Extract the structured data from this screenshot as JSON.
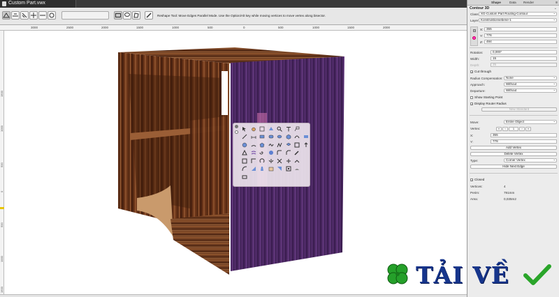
{
  "window": {
    "title": "Custom Part.vwx"
  },
  "toolbar": {
    "hint": "Reshape Tool: Move Edges Parallel Mode. Use the Option/Alt key while moving vertices to move vertex along bisector."
  },
  "rulers": {
    "top": [
      "3000",
      "2500",
      "2000",
      "1500",
      "1000",
      "500",
      "0",
      "500",
      "1000",
      "1500",
      "2000"
    ],
    "left": [
      "1500",
      "1000",
      "500",
      "0",
      "500",
      "1000",
      "1500"
    ]
  },
  "inspector": {
    "tabs": [
      "Shape",
      "Data",
      "Render"
    ],
    "object_type": "Contour 3D",
    "class_label": "Class:",
    "class_value": "XG-Custom Part Routing-Contour",
    "layer_label": "Layer:",
    "layer_value": "Konstruktionsebene-1",
    "x_label": "X:",
    "x_value": "355",
    "y_label": "Y:",
    "y_value": "776",
    "z_label": "Z:",
    "z_value": "484",
    "rotation_label": "Rotation:",
    "rotation_value": "0,000°",
    "width_label": "Width:",
    "width_value": "15",
    "depth_label": "Depth:",
    "depth_value": "25",
    "cut_through": "Cut through",
    "radius_comp_label": "Radius Compensation:",
    "radius_comp_value": "None",
    "approach_label": "Approach:",
    "approach_value": "Without",
    "departure_label": "Departure:",
    "departure_value": "Without",
    "show_starting_point": "Show Starting Point",
    "display_router_radius": "Display Router Radius",
    "new_standard": "New Standard",
    "move_label": "Move:",
    "move_value": "Entire Object",
    "vertex_label": "Vertex:",
    "vx_label": "X:",
    "vx_value": "355",
    "vy_label": "Y:",
    "vy_value": "778",
    "add_vertex": "Add Vertex",
    "delete_vertex": "Delete Vertex",
    "type_label": "Type:",
    "type_value": "Corner Vertex",
    "hide_next_edge": "Hide Next Edge",
    "closed": "Closed",
    "vertices_label": "Vertices:",
    "vertices_value": "4",
    "perim_label": "Perim:",
    "perim_value": "791mm",
    "area_label": "Area:",
    "area_value": "0,035m2"
  },
  "watermark": {
    "text": "TẢI VỀ"
  },
  "colors": {
    "wood_dark": "#5b2e17",
    "wood_light": "#8a4f2b",
    "panel_purple": "#4e2a66",
    "watermark_blue": "#16358c",
    "check_green": "#2aa52a"
  }
}
